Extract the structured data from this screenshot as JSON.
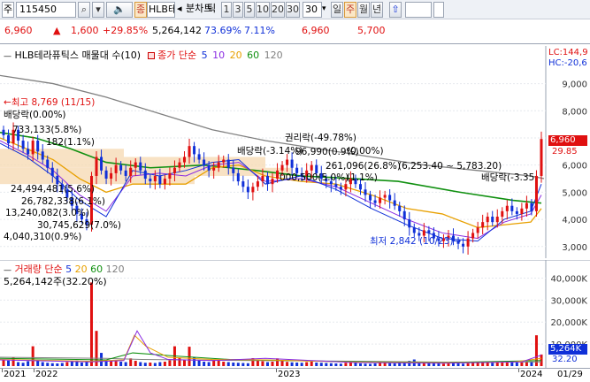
{
  "toolbar": {
    "market_label": "주",
    "code_value": "115450",
    "tag_label": "종",
    "stock_name": "HLB테",
    "bunchart_label": "분차트",
    "tick_label": "틱",
    "intervals": [
      "1",
      "3",
      "5",
      "10",
      "20",
      "30"
    ],
    "interval_value": "30",
    "periods": [
      "일",
      "주",
      "월",
      "년"
    ]
  },
  "quote": {
    "price": "6,960",
    "change": "1,600",
    "change_pct": "+29.85%",
    "volume": "5,264,142",
    "volume_ratio": "73.69%",
    "turnover": "7.11%",
    "high": "6,960",
    "low": "5,700"
  },
  "price_panel": {
    "legend_name": "HLB테라퓨틱스 매물대 수(10)",
    "legend_ma": "종가 단순",
    "ma_periods": [
      "5",
      "10",
      "20",
      "60",
      "120"
    ],
    "limit_high": "LC:144,9",
    "limit_low": "HC:-20,6",
    "y_ticks": [
      "9,000",
      "8,000",
      "7,000",
      "6,000",
      "5,000",
      "4,000",
      "3,000"
    ],
    "last_price": "6,960",
    "last_change": "29.85",
    "annotations": {
      "high_marker": "최고 8,769 (11/15)",
      "low_marker": "최저 2,842 (10/23)",
      "dividend_left": "배당락(0.00%)",
      "dividend_mid": "배당락(-3.14%)",
      "rights": "권리락(-49.78%)",
      "dividend_right": "배당락(-3.35",
      "dividend_pct": "(0.00%)",
      "range_label": "(6,253.40 ~ 5,783.20)"
    },
    "volume_profile": [
      "733,133(5.8%)",
      "182(1.1%)",
      "24,494,481(5.6%)",
      "26,782,338(6.1%)",
      "13,240,082(3.0%)",
      "30,745,629(7.0%)",
      "4,040,310(0.9%)",
      "261,096(26.8%)",
      "96,990(0.9%)",
      "(1.1%)",
      "000,500(5.0%)"
    ]
  },
  "volume_panel": {
    "legend_name": "거래량",
    "legend_ma": "단순",
    "ma_periods": [
      "5",
      "20",
      "60",
      "120"
    ],
    "current_value": "5,264,142주(32.20%)",
    "y_ticks": [
      "40,000K",
      "30,000K",
      "20,000K",
      "10,000K"
    ],
    "last_volume": "5,264K",
    "last_pct": "32.20"
  },
  "x_axis": {
    "labels": [
      "2021",
      "2022",
      "2023",
      "2024",
      "01/29"
    ]
  },
  "colors": {
    "up": "#e01010",
    "down": "#1030d8",
    "ma5": "#1030d8",
    "ma10": "#8a2be2",
    "ma20": "#e8a000",
    "ma60": "#109010",
    "ma120": "#808080",
    "profile": "#f6d8b0"
  }
}
